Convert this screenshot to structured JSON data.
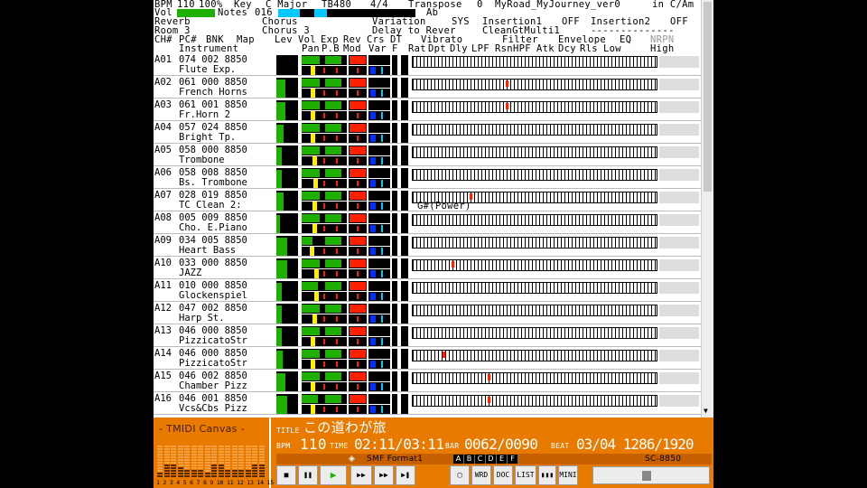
{
  "header": {
    "bpm_label": "BPM",
    "bpm": "110",
    "percent": "100%",
    "key_label": "Key",
    "key": "C Major",
    "tb": "TB480",
    "meter": "4/4",
    "transpose_label": "Transpose",
    "transpose": "0",
    "song_file": "MyRoad_MyJourney_ver0",
    "mode": "in C/Am",
    "vol_label": "Vol",
    "notes_label": "Notes",
    "notes_val": "016",
    "ab": "Ab",
    "reverb_label": "Reverb",
    "reverb": "Room 3",
    "chorus_label": "Chorus",
    "chorus": "Chorus 3",
    "variation_label": "Variation",
    "variation": "Delay to Rever",
    "sys": "SYS",
    "ins1_label": "Insertion1",
    "ins1_state": "OFF",
    "ins1": "CleanGtMulti1",
    "ins2_label": "Insertion2",
    "ins2_state": "OFF",
    "ins2": "--------------"
  },
  "columns": {
    "top": [
      "CH#",
      "PC#",
      "BNK",
      "Map",
      "Lev",
      "Vol",
      "Exp",
      "Rev",
      "Crs",
      "DT",
      "Vibrato",
      "Filter",
      "Envelope",
      "EQ",
      "NRPN"
    ],
    "bottom": [
      "Instrument",
      "Pan",
      "P.B",
      "Mod",
      "Var",
      "F",
      "Rat",
      "Dpt",
      "Dly",
      "LPF",
      "Rsn",
      "HPF",
      "Atk",
      "Dcy",
      "Rls",
      "Low",
      "High"
    ]
  },
  "channels": [
    {
      "ch": "A01",
      "prog": "074 002 8850",
      "name": "Flute Exp."
    },
    {
      "ch": "A02",
      "prog": "061 000 8850",
      "name": "French Horns"
    },
    {
      "ch": "A03",
      "prog": "061 001 8850",
      "name": "Fr.Horn 2"
    },
    {
      "ch": "A04",
      "prog": "057 024 8850",
      "name": "Bright Tp."
    },
    {
      "ch": "A05",
      "prog": "058 000 8850",
      "name": "Trombone"
    },
    {
      "ch": "A06",
      "prog": "058 008 8850",
      "name": "Bs. Trombone"
    },
    {
      "ch": "A07",
      "prog": "028 019 8850",
      "name": "TC Clean 2:",
      "chord": "G#(Power)"
    },
    {
      "ch": "A08",
      "prog": "005 009 8850",
      "name": "Cho. E.Piano"
    },
    {
      "ch": "A09",
      "prog": "034 005 8850",
      "name": "Heart Bass"
    },
    {
      "ch": "A10",
      "prog": "033 000 8850",
      "name": "JAZZ"
    },
    {
      "ch": "A11",
      "prog": "010 000 8850",
      "name": "Glockenspiel"
    },
    {
      "ch": "A12",
      "prog": "047 002 8850",
      "name": "Harp St."
    },
    {
      "ch": "A13",
      "prog": "046 000 8850",
      "name": "PizzicatoStr"
    },
    {
      "ch": "A14",
      "prog": "046 000 8850",
      "name": "PizzicatoStr"
    },
    {
      "ch": "A15",
      "prog": "046 002 8850",
      "name": "Chamber Pizz"
    },
    {
      "ch": "A16",
      "prog": "046 001 8850",
      "name": "Vcs&Cbs Pizz"
    }
  ],
  "player": {
    "logo": "- TMIDI Canvas -",
    "title_label": "TITLE",
    "title": "この道わが旅",
    "bpm_label": "BPM",
    "bpm": "110",
    "time_label": "TIME",
    "time": "02:11/03:11",
    "bar_label": "BAR",
    "bar": "0062/0090",
    "beat_label": "BEAT",
    "beat": "03/04 1286/1920",
    "format": "SMF Format1",
    "ports": [
      "A",
      "B",
      "C",
      "D",
      "E",
      "F"
    ],
    "module": "SC-8850",
    "meter_labels": "1 2 3 4 5 6 7 8 9 10 11 12 13 14 15 16",
    "buttons": [
      "■",
      "❚❚",
      "▶",
      "▶▶",
      "▶▶",
      "▶❚",
      "▢",
      "WRD",
      "DOC",
      "LIST",
      "▮▮▮",
      "MINI"
    ]
  },
  "colors": {
    "accent": "#e87a00",
    "green": "#1db000",
    "red": "#ff2000",
    "blue": "#0030ff",
    "yellow": "#ffee00",
    "cyan": "#00c8ff"
  }
}
